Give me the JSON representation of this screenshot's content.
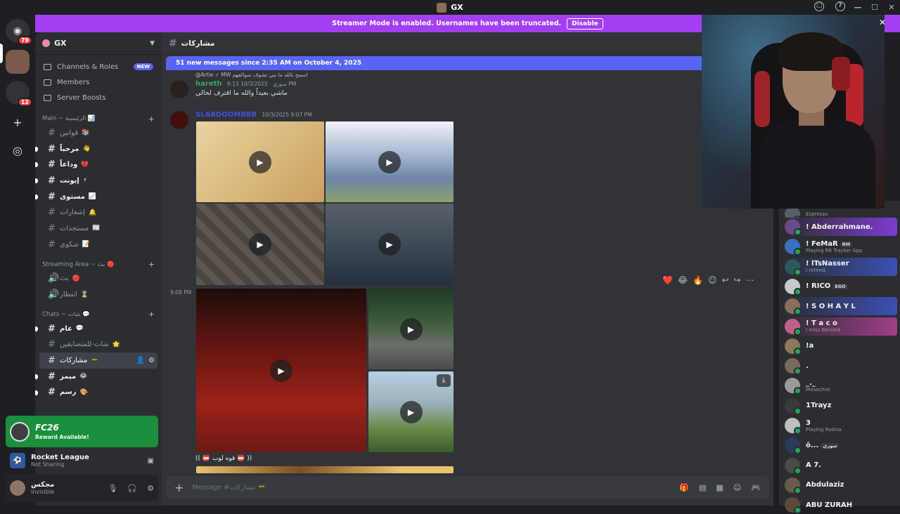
{
  "titlebar": {
    "server": "GX"
  },
  "guilds": {
    "dm_badge": "79",
    "second_badge": "12"
  },
  "streamer_banner": {
    "text": "Streamer Mode is enabled. Usernames have been truncated.",
    "button": "Disable"
  },
  "server": {
    "name": "GX",
    "nav": [
      {
        "label": "Channels & Roles",
        "badge": "NEW"
      },
      {
        "label": "Members"
      },
      {
        "label": "Server Boosts"
      }
    ]
  },
  "categories": [
    {
      "label": "Main ~ الرئيسية 📊"
    },
    {
      "label": "Streaming Area ~ بث 🔴"
    },
    {
      "label": "Chats ~ شات 💬"
    }
  ],
  "channels_main": [
    {
      "name": "قوانين",
      "emoji": "📚",
      "unread": false
    },
    {
      "name": "مرحباً",
      "emoji": "👋",
      "unread": true
    },
    {
      "name": "وداعاً",
      "emoji": "💔",
      "unread": true
    },
    {
      "name": "إيونت",
      "emoji": "⚡",
      "unread": true
    },
    {
      "name": "مستوى",
      "emoji": "📈",
      "unread": true
    },
    {
      "name": "إشعارات",
      "emoji": "🔔",
      "unread": false
    },
    {
      "name": "مستجدات",
      "emoji": "📰",
      "unread": false
    },
    {
      "name": "شكوى",
      "emoji": "📝",
      "unread": false
    }
  ],
  "channels_stream": [
    {
      "name": "بث",
      "emoji": "🔴"
    },
    {
      "name": "انتظار",
      "emoji": "⏳"
    }
  ],
  "channels_chat": [
    {
      "name": "عام",
      "emoji": "💬",
      "unread": true,
      "sel": false
    },
    {
      "name": "شات-للمتضايقين",
      "emoji": "🌟",
      "unread": false,
      "sel": false
    },
    {
      "name": "مشاركات",
      "emoji": "📟",
      "unread": false,
      "sel": true
    },
    {
      "name": "ميمز",
      "emoji": "😂",
      "unread": true,
      "sel": false
    },
    {
      "name": "رسم",
      "emoji": "🎨",
      "unread": true,
      "sel": false
    }
  ],
  "reward": {
    "title": "FC26",
    "subtitle": "Reward Available!"
  },
  "activity": {
    "title": "Rocket League",
    "subtitle": "Not Sharing"
  },
  "user": {
    "name": "مجكس",
    "status": "Invisible"
  },
  "chat": {
    "channel": "مشاركات",
    "new_messages": "51 new messages since 2:35 AM on October 4, 2025",
    "reply_preview": "@Artie ✓ MW  اسمح بالله ما نبي تشوف سوالفهم",
    "msg1": {
      "author": "hareth",
      "tag": "سوري",
      "time": "10/3/2025 8:13 PM",
      "text": "ماشي بعيداً والله ما اقترف لحالي"
    },
    "msg2": {
      "author": "SLABDOOMBBB",
      "time": "10/3/2025 9:07 PM"
    },
    "side_time": "9:08 PM",
    "caption": "(( 📛 قوه لوب 📛 ))",
    "composer_placeholder": "Message #مشاركات 📟"
  },
  "reactions": [
    "❤️",
    "😂",
    "🔥"
  ],
  "members": [
    {
      "name": "",
      "sub": "Espresso"
    },
    {
      "name": "! Abderrahmane.",
      "sub": ""
    },
    {
      "name": "! FeMaR",
      "tag": "RM",
      "sub": "Playing R6 Tracker App"
    },
    {
      "name": "! lTsNasser",
      "sub": "I retired."
    },
    {
      "name": "! RICO",
      "tag": "EGO",
      "sub": ""
    },
    {
      "name": "! S O H A Y L",
      "sub": ""
    },
    {
      "name": "! T a c o",
      "sub": "I miss Berserk"
    },
    {
      "name": "!a",
      "sub": ""
    },
    {
      "name": ".",
      "sub": ""
    },
    {
      "name": "_._",
      "sub": "Masochist"
    },
    {
      "name": "1Trayz",
      "sub": ""
    },
    {
      "name": "3",
      "sub": "Playing Roblox"
    },
    {
      "name": "ō...",
      "tag": "سوري",
      "sub": ""
    },
    {
      "name": "A 7.",
      "sub": ""
    },
    {
      "name": "Abdulaziz",
      "sub": ""
    },
    {
      "name": "ABU ZURAH",
      "sub": ""
    }
  ],
  "colors": {
    "accent": "#5865f2",
    "streamer": "#a23ff0",
    "reward": "#1b8f3d"
  }
}
